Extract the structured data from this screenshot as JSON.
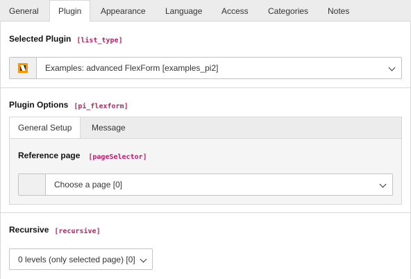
{
  "tabs": [
    {
      "label": "General"
    },
    {
      "label": "Plugin"
    },
    {
      "label": "Appearance"
    },
    {
      "label": "Language"
    },
    {
      "label": "Access"
    },
    {
      "label": "Categories"
    },
    {
      "label": "Notes"
    }
  ],
  "active_tab": "Plugin",
  "selected_plugin": {
    "label": "Selected Plugin",
    "code": "[list_type]",
    "value": "Examples: advanced FlexForm [examples_pi2]",
    "icon": "plugin-icon",
    "icon_color": "#f49700"
  },
  "plugin_options": {
    "label": "Plugin Options",
    "code": "[pi_flexform]",
    "inner_tabs": [
      {
        "label": "General Setup"
      },
      {
        "label": "Message"
      }
    ],
    "active_inner_tab": "General Setup",
    "reference_page": {
      "label": "Reference page",
      "code": "[pageSelector]",
      "value": "Choose a page [0]"
    }
  },
  "recursive": {
    "label": "Recursive",
    "code": "[recursive]",
    "value": "0 levels (only selected page) [0]"
  }
}
